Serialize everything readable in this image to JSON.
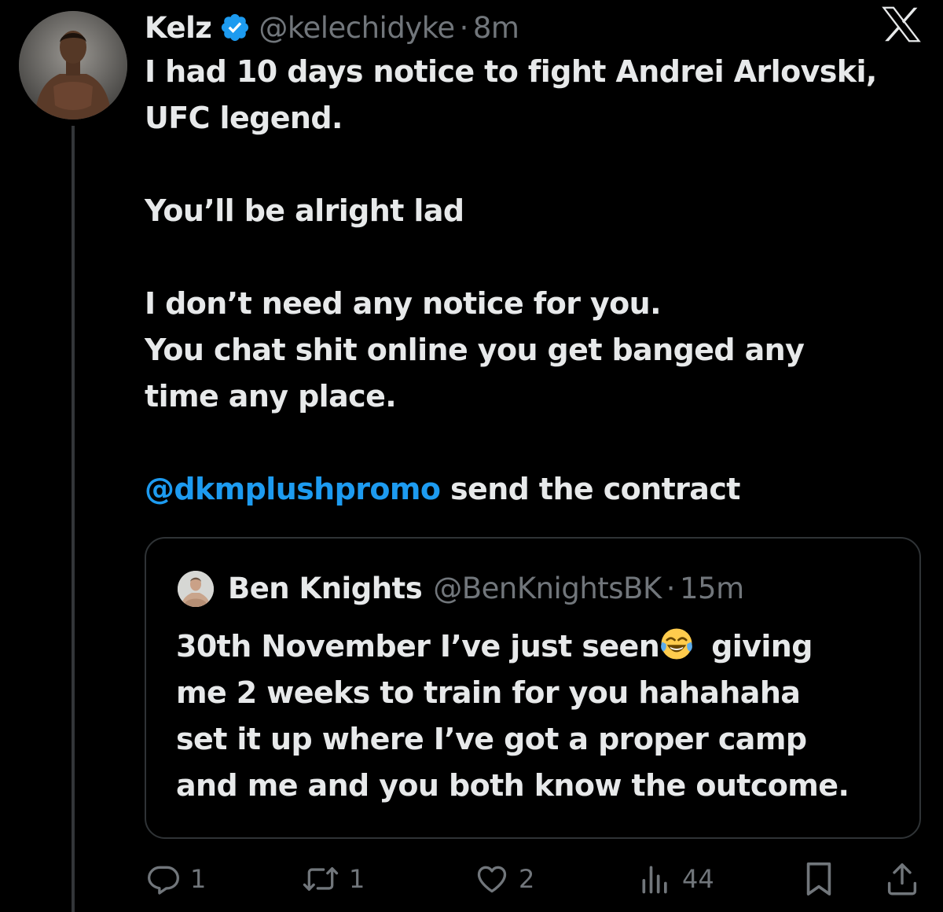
{
  "author": {
    "name": "Kelz",
    "handle": "@kelechidyke",
    "separator": "·",
    "time": "8m"
  },
  "tweet": {
    "lines": [
      "I had 10 days notice to fight Andrei Arlovski,",
      "UFC legend.",
      "You’ll be alright lad",
      "I don’t need any notice for you.",
      "You chat shit online you get banged any",
      "time any place."
    ],
    "mention": "@dkmplushpromo",
    "mention_suffix": " send the contract"
  },
  "quote": {
    "name": "Ben Knights",
    "handle": "@BenKnightsBK",
    "separator": "·",
    "time": "15m",
    "line1_before_emoji": "30th November I’ve just seen",
    "line1_after_emoji": "giving",
    "lines": [
      "me 2 weeks to train for you hahahaha",
      "set it up where I’ve got a proper camp",
      "and me and you both know the outcome."
    ]
  },
  "actions": {
    "replies": "1",
    "reposts": "1",
    "likes": "2",
    "views": "44"
  },
  "icons": {
    "verified": "verified-badge-icon",
    "logo": "x-logo-icon",
    "reply": "reply-icon",
    "repost": "repost-icon",
    "like": "heart-icon",
    "views": "views-icon",
    "bookmark": "bookmark-icon",
    "share": "share-icon",
    "emoji": "face-with-tears-of-joy-icon"
  },
  "colors": {
    "background": "#000000",
    "text": "#e7e9ea",
    "secondary": "#71767b",
    "link": "#1d9bf0",
    "border": "#2f3336"
  }
}
